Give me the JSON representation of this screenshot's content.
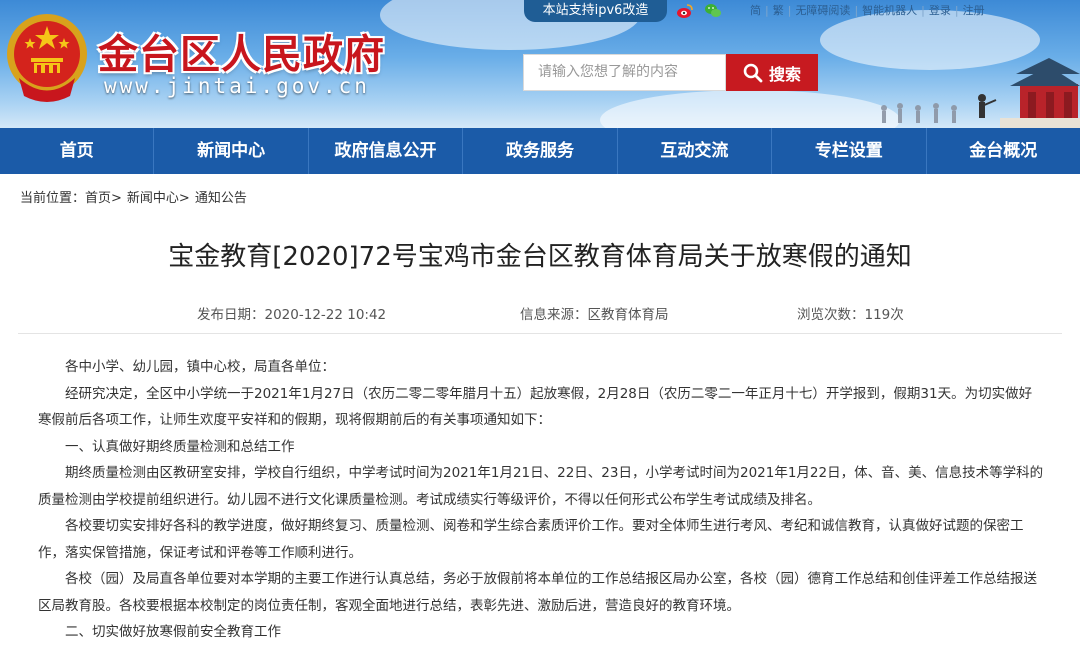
{
  "header": {
    "site_title": "金台区人民政府",
    "site_url": "www.jintai.gov.cn",
    "ipv6_badge": "本站支持ipv6改造",
    "top_links": [
      "简",
      "繁",
      "无障碍阅读",
      "智能机器人",
      "登录",
      "注册"
    ],
    "search": {
      "placeholder": "请输入您想了解的内容",
      "button_label": "搜索"
    }
  },
  "nav": {
    "items": [
      "首页",
      "新闻中心",
      "政府信息公开",
      "政务服务",
      "互动交流",
      "专栏设置",
      "金台概况"
    ]
  },
  "breadcrumb": {
    "prefix": "当前位置：",
    "items": [
      "首页>",
      "新闻中心>",
      "通知公告"
    ]
  },
  "article": {
    "title": "宝金教育[2020]72号宝鸡市金台区教育体育局关于放寒假的通知",
    "publish_date": "发布日期：2020-12-22 10:42",
    "source": "信息来源：区教育体育局",
    "views": "浏览次数：119次",
    "paragraphs": [
      "各中小学、幼儿园，镇中心校，局直各单位：",
      "经研究决定，全区中小学统一于2021年1月27日（农历二零二零年腊月十五）起放寒假，2月28日（农历二零二一年正月十七）开学报到，假期31天。为切实做好寒假前后各项工作，让师生欢度平安祥和的假期，现将假期前后的有关事项通知如下：",
      "一、认真做好期终质量检测和总结工作",
      "期终质量检测由区教研室安排，学校自行组织，中学考试时间为2021年1月21日、22日、23日，小学考试时间为2021年1月22日，体、音、美、信息技术等学科的质量检测由学校提前组织进行。幼儿园不进行文化课质量检测。考试成绩实行等级评价，不得以任何形式公布学生考试成绩及排名。",
      "各校要切实安排好各科的教学进度，做好期终复习、质量检测、阅卷和学生综合素质评价工作。要对全体师生进行考风、考纪和诚信教育，认真做好试题的保密工作，落实保管措施，保证考试和评卷等工作顺利进行。",
      "各校（园）及局直各单位要对本学期的主要工作进行认真总结，务必于放假前将本单位的工作总结报区局办公室，各校（园）德育工作总结和创佳评差工作总结报送区局教育股。各校要根据本校制定的岗位责任制，客观全面地进行总结，表彰先进、激励后进，营造良好的教育环境。",
      "二、切实做好放寒假前安全教育工作"
    ]
  },
  "colors": {
    "nav_bg": "#1b5ba8",
    "title_red": "#c8161d",
    "search_button": "#c71a20",
    "ipv6_badge_bg": "#1f5d95"
  }
}
